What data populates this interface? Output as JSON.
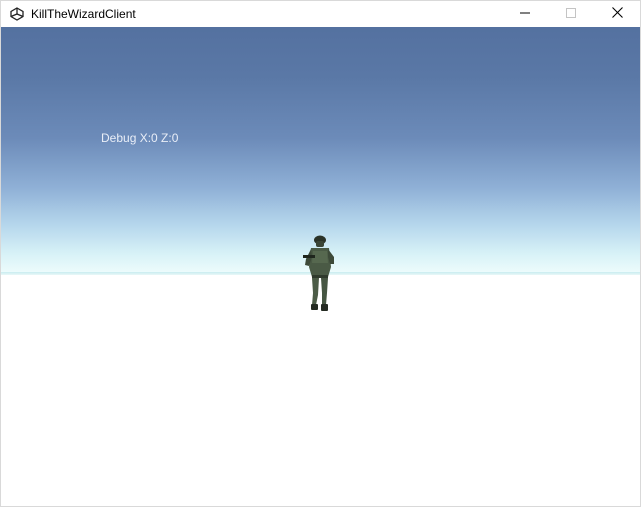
{
  "window": {
    "title": "KillTheWizardClient",
    "icon": "unity-icon",
    "controls": {
      "minimize_icon": "minimize-icon",
      "maximize_icon": "maximize-icon",
      "close_icon": "close-icon"
    }
  },
  "game": {
    "debug_text": "Debug X:0 Z:0",
    "colors": {
      "sky_top": "#5471a0",
      "sky_horizon": "#eefcfc",
      "ground": "#ffffff",
      "debug_text": "#e9eef7"
    }
  }
}
